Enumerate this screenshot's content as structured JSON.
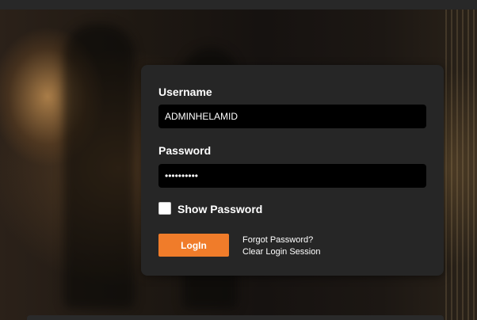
{
  "login": {
    "username_label": "Username",
    "username_value": "ADMINHELAMID",
    "password_label": "Password",
    "password_value": "mypassword",
    "show_password_label": "Show Password",
    "show_password_checked": false,
    "login_button": "LogIn",
    "forgot_password_link": "Forgot Password?",
    "clear_session_link": "Clear Login Session"
  },
  "colors": {
    "card_background": "#262626",
    "input_background": "#000000",
    "accent": "#f07c2a"
  }
}
